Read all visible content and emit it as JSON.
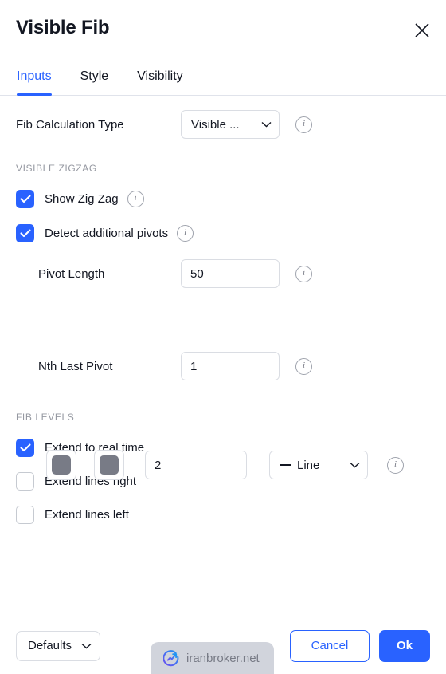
{
  "header": {
    "title": "Visible Fib",
    "close_icon": "close-icon"
  },
  "tabs": [
    {
      "label": "Inputs",
      "active": true
    },
    {
      "label": "Style",
      "active": false
    },
    {
      "label": "Visibility",
      "active": false
    }
  ],
  "inputs": {
    "fib_calculation_type": {
      "label": "Fib Calculation Type",
      "value": "Visible ...",
      "info": "i"
    },
    "sections": [
      {
        "label": "Visible ZigZag"
      },
      {
        "label": "Fib Levels"
      }
    ],
    "show_zig_zag": {
      "label": "Show Zig Zag",
      "checked": true,
      "info": "i"
    },
    "detect_additional_pivots": {
      "label": "Detect additional pivots",
      "checked": true,
      "info": "i"
    },
    "pivot_length": {
      "label": "Pivot Length",
      "value": "50",
      "info": "i"
    },
    "line_style_row": {
      "color_1": "#787b86",
      "color_2": "#787b86",
      "width_value": "2",
      "style_value": "Line",
      "info": "i"
    },
    "nth_last_pivot": {
      "label": "Nth Last Pivot",
      "value": "1",
      "info": "i"
    },
    "extend_to_real_time": {
      "label": "Extend to real time",
      "checked": true
    },
    "extend_lines_right": {
      "label": "Extend lines right",
      "checked": false
    },
    "extend_lines_left": {
      "label": "Extend lines left",
      "checked": false
    }
  },
  "footer": {
    "defaults_label": "Defaults",
    "cancel_label": "Cancel",
    "ok_label": "Ok"
  },
  "watermark": {
    "text": "iranbroker.net",
    "icon": "chart-arrow-logo-icon"
  },
  "colors": {
    "accent": "#2962ff",
    "text": "#131722",
    "muted": "#9598a1",
    "border": "#dadde3",
    "swatch": "#787b86",
    "watermark_bg": "#d1d4dc"
  }
}
